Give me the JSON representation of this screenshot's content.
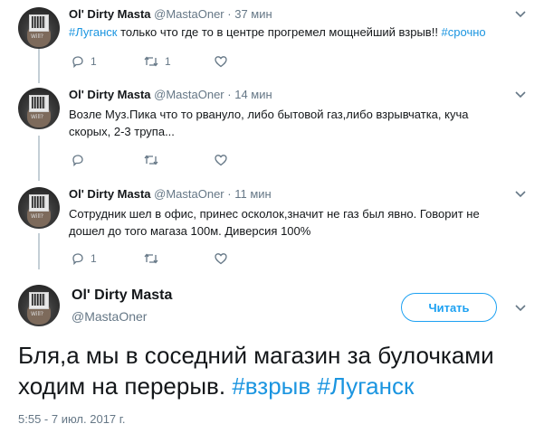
{
  "thread": [
    {
      "author": {
        "name": "Ol' Dirty Masta",
        "handle": "@MastaOner"
      },
      "time": "37 мин",
      "text_parts": [
        {
          "text": "#Луганск",
          "tag": true
        },
        {
          "text": " только что где то в центре прогремел мощнейший взрыв!! ",
          "tag": false
        },
        {
          "text": "#срочно",
          "tag": true
        }
      ],
      "replies": "1",
      "retweets": "1",
      "likes": ""
    },
    {
      "author": {
        "name": "Ol' Dirty Masta",
        "handle": "@MastaOner"
      },
      "time": "14 мин",
      "text_lines": [
        "Возле Муз.Пика что то рвануло, либо бытовой газ,либо взрывчатка, куча",
        "скорых, 2-3 трупа..."
      ],
      "replies": "",
      "retweets": "",
      "likes": ""
    },
    {
      "author": {
        "name": "Ol' Dirty Masta",
        "handle": "@MastaOner"
      },
      "time": "11 мин",
      "text_lines": [
        "Сотрудник шел в офис, принес осколок,значит не газ был явно. Говорит не",
        "дошел до того магаза 100м. Диверсия 100%"
      ],
      "replies": "1",
      "retweets": "",
      "likes": ""
    }
  ],
  "main": {
    "author": {
      "name": "Ol' Dirty Masta",
      "handle": "@MastaOner"
    },
    "follow_label": "Читать",
    "text_line1": "Бля,а мы в соседний магазин за булочками",
    "text_line2_plain": "ходим на перерыв. ",
    "tag1": "#взрыв",
    "tag2": "#Луганск",
    "date": "5:55 - 7 июл. 2017 г."
  },
  "avatar_caption": "Will?",
  "colors": {
    "accent": "#1da1f2",
    "hashtag": "#1b95e0",
    "muted": "#657786",
    "thread_line": "#c4cfd6"
  }
}
